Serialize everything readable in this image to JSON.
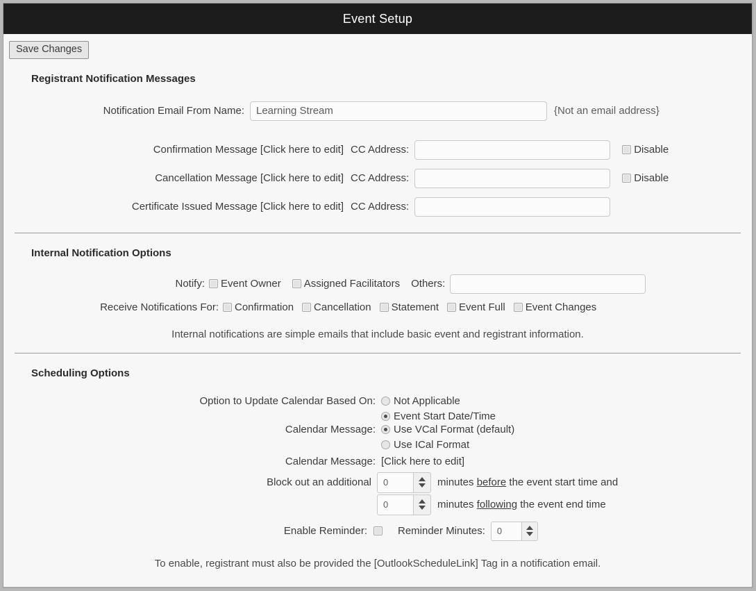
{
  "window": {
    "title": "Event Setup"
  },
  "toolbar": {
    "save_label": "Save Changes"
  },
  "registrant_section": {
    "heading": "Registrant Notification Messages",
    "from_name_label": "Notification Email From Name:",
    "from_name_value": "Learning Stream",
    "from_name_hint": "{Not an email address}",
    "messages": [
      {
        "label": "Confirmation Message [Click here to edit]",
        "cc_label": "CC Address:",
        "cc_value": "",
        "disable_label": "Disable",
        "has_disable": true
      },
      {
        "label": "Cancellation Message [Click here to edit]",
        "cc_label": "CC Address:",
        "cc_value": "",
        "disable_label": "Disable",
        "has_disable": true
      },
      {
        "label": "Certificate Issued Message [Click here to edit]",
        "cc_label": "CC Address:",
        "cc_value": "",
        "disable_label": "",
        "has_disable": false
      }
    ]
  },
  "internal_section": {
    "heading": "Internal Notification Options",
    "notify_label": "Notify:",
    "notify_options": [
      {
        "label": "Event Owner",
        "checked": false
      },
      {
        "label": "Assigned Facilitators",
        "checked": false
      }
    ],
    "others_label": "Others:",
    "others_value": "",
    "receive_label": "Receive Notifications For:",
    "receive_options": [
      {
        "label": "Confirmation",
        "checked": false
      },
      {
        "label": "Cancellation",
        "checked": false
      },
      {
        "label": "Statement",
        "checked": false
      },
      {
        "label": "Event Full",
        "checked": false
      },
      {
        "label": "Event Changes",
        "checked": false
      }
    ],
    "note": "Internal notifications are simple emails that include basic event and registrant information."
  },
  "scheduling_section": {
    "heading": "Scheduling Options",
    "update_calendar_label": "Option to Update Calendar Based On:",
    "update_calendar_options": [
      {
        "label": "Not Applicable",
        "selected": false
      },
      {
        "label": "Event Start Date/Time",
        "selected": true
      }
    ],
    "calendar_format_label": "Calendar Message:",
    "calendar_format_options": [
      {
        "label": "Use VCal Format (default)",
        "selected": true
      },
      {
        "label": "Use ICal Format",
        "selected": false
      }
    ],
    "calendar_message_label": "Calendar Message:",
    "calendar_message_link": "[Click here to edit]",
    "block_out_label": "Block out an additional",
    "block_before": {
      "value": "0",
      "text_pre": "minutes ",
      "text_em": "before",
      "text_post": " the event start time and"
    },
    "block_after": {
      "value": "0",
      "text_pre": "minutes ",
      "text_em": "following",
      "text_post": " the event end time"
    },
    "enable_reminder_label": "Enable Reminder:",
    "enable_reminder_checked": false,
    "reminder_minutes_label": "Reminder Minutes:",
    "reminder_minutes_value": "0",
    "note": "To enable, registrant must also be provided the [OutlookScheduleLink] Tag in a notification email."
  }
}
